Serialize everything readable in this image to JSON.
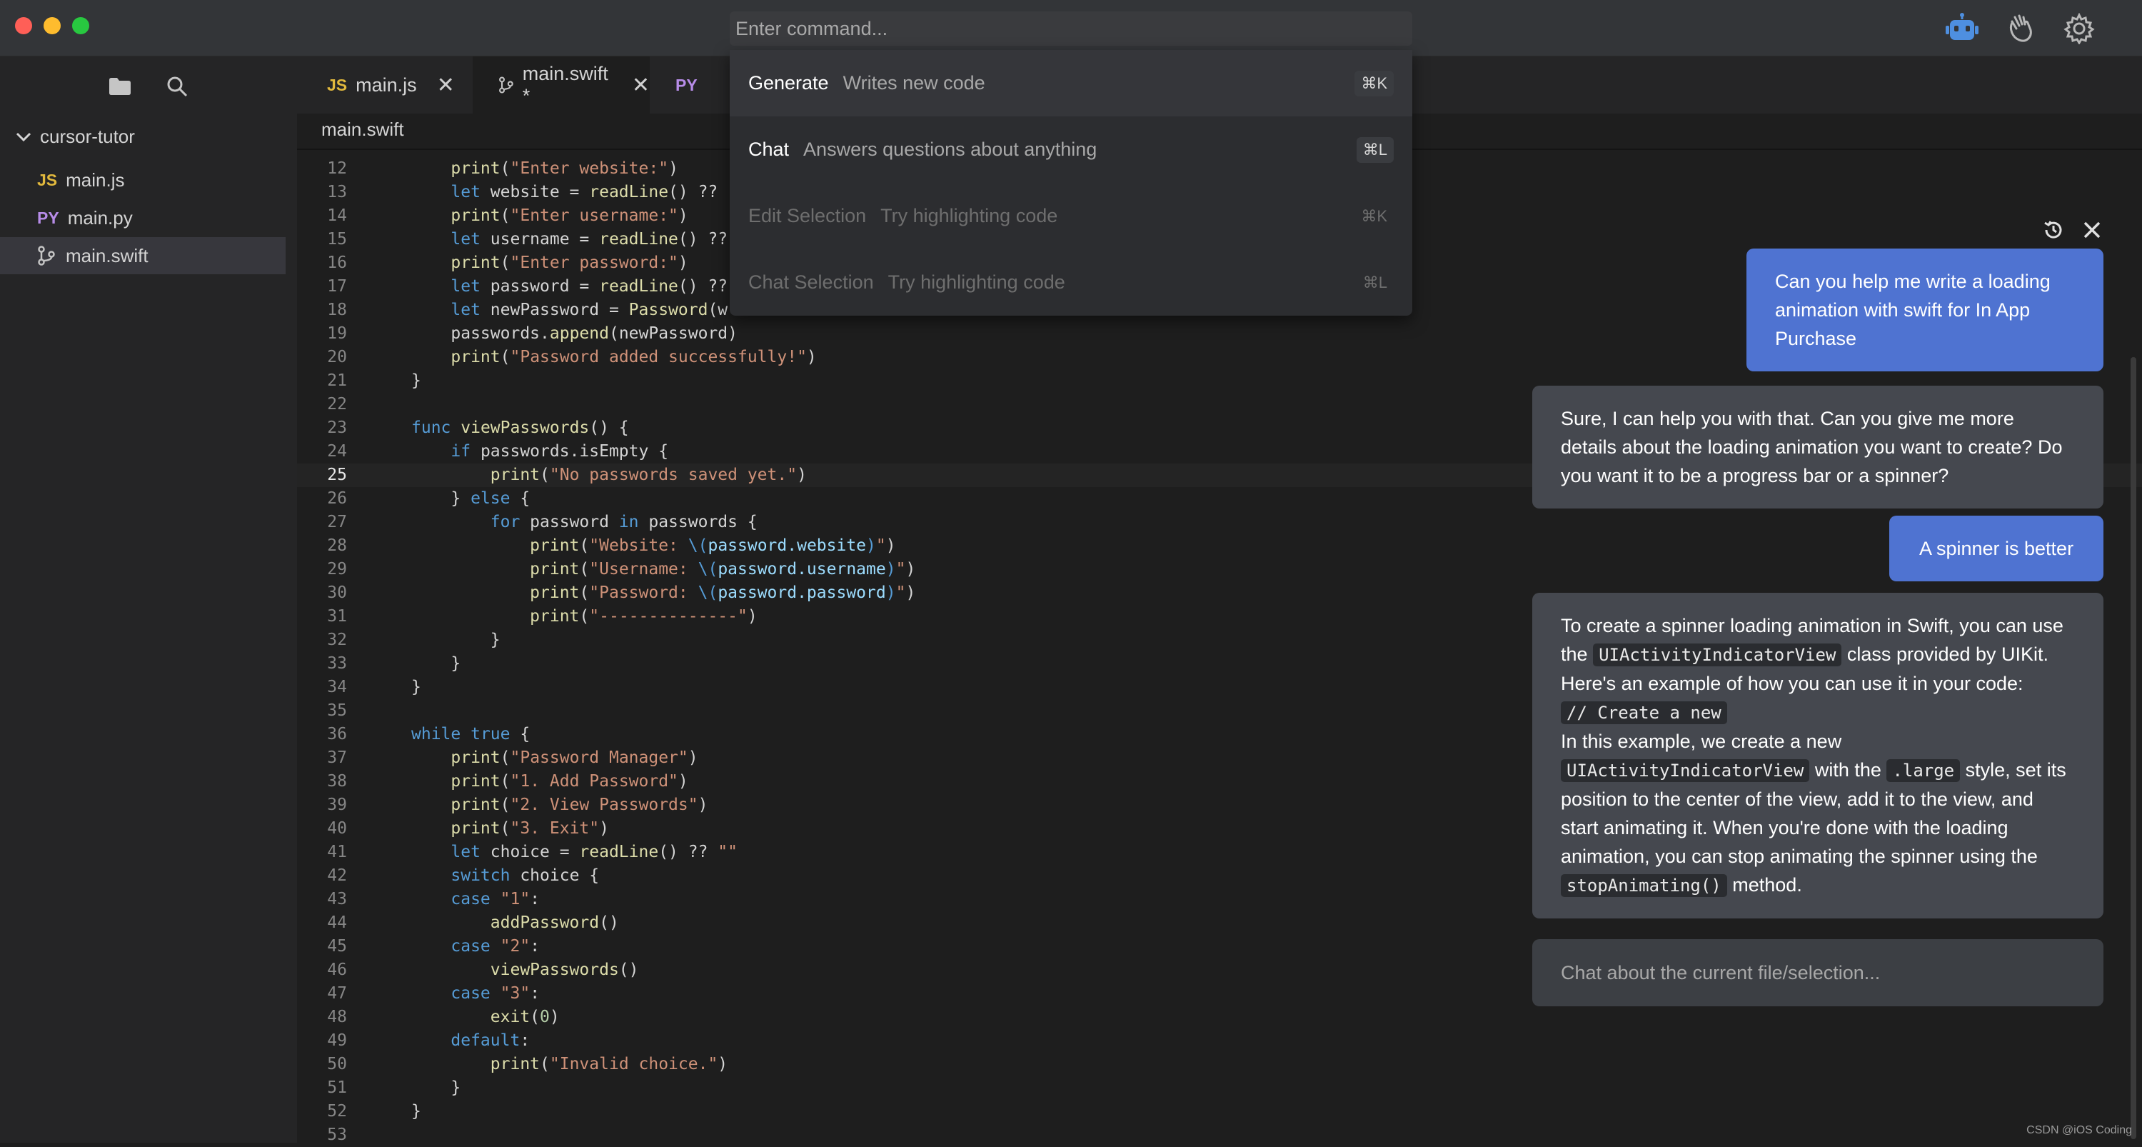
{
  "command_bar": {
    "placeholder": "Enter command..."
  },
  "top_icons": [
    "robot-icon",
    "hand-wave-icon",
    "gear-icon"
  ],
  "sidebar": {
    "folder": "cursor-tutor",
    "files": [
      {
        "badge": "JS",
        "badge_color": "#e2b93d",
        "name": "main.js"
      },
      {
        "badge": "PY",
        "badge_color": "#b78ce8",
        "name": "main.py"
      },
      {
        "badge": "branch-icon",
        "name": "main.swift",
        "active": true
      }
    ]
  },
  "tabs": [
    {
      "badge": "JS",
      "name": "main.js"
    },
    {
      "name": "main.swift *",
      "active": true
    },
    {
      "badge": "PY"
    }
  ],
  "breadcrumb": "main.swift",
  "command_menu": [
    {
      "name": "Generate",
      "desc": "Writes new code",
      "key": "⌘K"
    },
    {
      "name": "Chat",
      "desc": "Answers questions about anything",
      "key": "⌘L"
    },
    {
      "name": "Edit Selection",
      "desc": "Try highlighting code",
      "key": "⌘K"
    },
    {
      "name": "Chat Selection",
      "desc": "Try highlighting code",
      "key": "⌘L"
    }
  ],
  "editor": {
    "current_line": "25",
    "lines": [
      {
        "n": "12",
        "t": "    print(\"Enter website:\")"
      },
      {
        "n": "13",
        "t": "    let website = readLine() ??"
      },
      {
        "n": "14",
        "t": "    print(\"Enter username:\")"
      },
      {
        "n": "15",
        "t": "    let username = readLine() ??"
      },
      {
        "n": "16",
        "t": "    print(\"Enter password:\")"
      },
      {
        "n": "17",
        "t": "    let password = readLine() ??"
      },
      {
        "n": "18",
        "t": "    let newPassword = Password(w"
      },
      {
        "n": "19",
        "t": "    passwords.append(newPassword)"
      },
      {
        "n": "20",
        "t": "    print(\"Password added successfully!\")"
      },
      {
        "n": "21",
        "t": "}"
      },
      {
        "n": "22",
        "t": ""
      },
      {
        "n": "23",
        "t": "func viewPasswords() {"
      },
      {
        "n": "24",
        "t": "    if passwords.isEmpty {"
      },
      {
        "n": "25",
        "t": "        print(\"No passwords saved yet.\")"
      },
      {
        "n": "26",
        "t": "    } else {"
      },
      {
        "n": "27",
        "t": "        for password in passwords {"
      },
      {
        "n": "28",
        "t": "            print(\"Website: \\(password.website)\")"
      },
      {
        "n": "29",
        "t": "            print(\"Username: \\(password.username)\")"
      },
      {
        "n": "30",
        "t": "            print(\"Password: \\(password.password)\")"
      },
      {
        "n": "31",
        "t": "            print(\"--------------\")"
      },
      {
        "n": "32",
        "t": "        }"
      },
      {
        "n": "33",
        "t": "    }"
      },
      {
        "n": "34",
        "t": "}"
      },
      {
        "n": "35",
        "t": ""
      },
      {
        "n": "36",
        "t": "while true {"
      },
      {
        "n": "37",
        "t": "    print(\"Password Manager\")"
      },
      {
        "n": "38",
        "t": "    print(\"1. Add Password\")"
      },
      {
        "n": "39",
        "t": "    print(\"2. View Passwords\")"
      },
      {
        "n": "40",
        "t": "    print(\"3. Exit\")"
      },
      {
        "n": "41",
        "t": "    let choice = readLine() ?? \"\""
      },
      {
        "n": "42",
        "t": "    switch choice {"
      },
      {
        "n": "43",
        "t": "    case \"1\":"
      },
      {
        "n": "44",
        "t": "        addPassword()"
      },
      {
        "n": "45",
        "t": "    case \"2\":"
      },
      {
        "n": "46",
        "t": "        viewPasswords()"
      },
      {
        "n": "47",
        "t": "    case \"3\":"
      },
      {
        "n": "48",
        "t": "        exit(0)"
      },
      {
        "n": "49",
        "t": "    default:"
      },
      {
        "n": "50",
        "t": "        print(\"Invalid choice.\")"
      },
      {
        "n": "51",
        "t": "    }"
      },
      {
        "n": "52",
        "t": "}"
      },
      {
        "n": "53",
        "t": ""
      }
    ]
  },
  "chat": {
    "messages": [
      {
        "role": "user",
        "text": "Can you help me write a loading animation with swift for In App Purchase"
      },
      {
        "role": "ai",
        "text": "Sure, I can help you with that. Can you give me more details about the loading animation you want to create? Do you want it to be a progress bar or a spinner?"
      },
      {
        "role": "user",
        "text": "A spinner is better"
      },
      {
        "role": "ai",
        "parts": {
          "p1": "To create a spinner loading animation in Swift, you can use the",
          "c1": "UIActivityIndicatorView",
          "p2": "class provided by UIKit. Here's an example of how you can use it in your code:",
          "c2": "// Create a new",
          "p3": "In this example, we create a new",
          "c3": "UIActivityIndicatorView",
          "p4": "with the",
          "c4": ".large",
          "p5": "style, set its position to the center of the view, add it to the view, and start animating it. When you're done with the loading animation, you can stop animating the spinner using the",
          "c5": "stopAnimating()",
          "p6": "method."
        }
      }
    ],
    "input_placeholder": "Chat about the current file/selection..."
  },
  "watermark": "CSDN @iOS Coding"
}
